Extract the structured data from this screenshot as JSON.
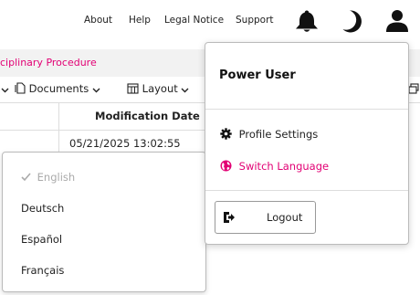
{
  "nav": {
    "about": "About",
    "help": "Help",
    "legal": "Legal Notice",
    "support": "Support",
    "bell_icon": "bell-icon",
    "theme_icon": "moon-icon",
    "user_icon": "user-icon"
  },
  "breadcrumb": {
    "text": "ciplinary Procedure"
  },
  "toolbar": {
    "filter_chevron": "chevron-down-icon",
    "documents_label": "Documents",
    "layout_label": "Layout"
  },
  "table": {
    "column_header": "Modification Date",
    "cell_value": "05/21/2025 13:02:55"
  },
  "language_menu": {
    "items": [
      {
        "label": "English",
        "selected": true
      },
      {
        "label": "Deutsch",
        "selected": false
      },
      {
        "label": "Español",
        "selected": false
      },
      {
        "label": "Français",
        "selected": false
      }
    ]
  },
  "user_menu": {
    "name": "Power User",
    "profile_settings": "Profile Settings",
    "switch_language": "Switch Language",
    "logout": "Logout"
  },
  "colors": {
    "accent": "#e20074",
    "disabled": "#aaaaaa"
  }
}
